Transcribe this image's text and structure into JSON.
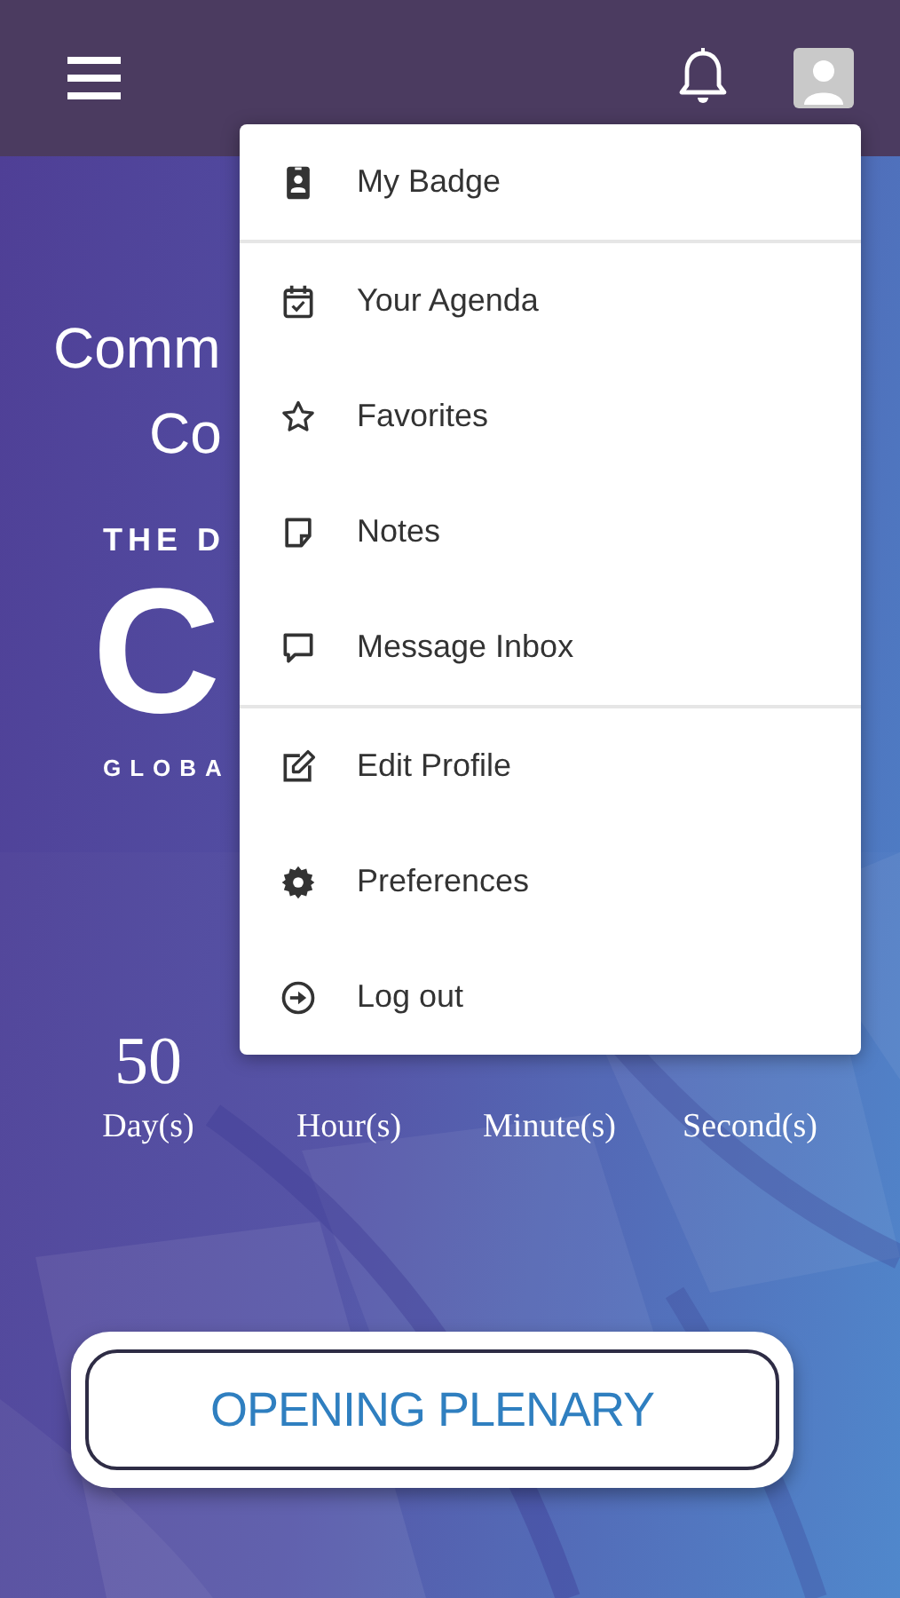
{
  "hero": {
    "title_lines": [
      "Comm",
      "Co"
    ],
    "logo_top": "THE D",
    "logo_letter": "C",
    "logo_bottom": "GLOBA"
  },
  "countdown": {
    "values": [
      "50"
    ],
    "labels": [
      "Day(s)",
      "Hour(s)",
      "Minute(s)",
      "Second(s)"
    ]
  },
  "button": {
    "label": "OPENING PLENARY"
  },
  "menu": {
    "sections": [
      [
        {
          "label": "My Badge"
        }
      ],
      [
        {
          "label": "Your Agenda"
        },
        {
          "label": "Favorites"
        },
        {
          "label": "Notes"
        },
        {
          "label": "Message Inbox"
        }
      ],
      [
        {
          "label": "Edit Profile"
        },
        {
          "label": "Preferences"
        },
        {
          "label": "Log out"
        }
      ]
    ]
  }
}
